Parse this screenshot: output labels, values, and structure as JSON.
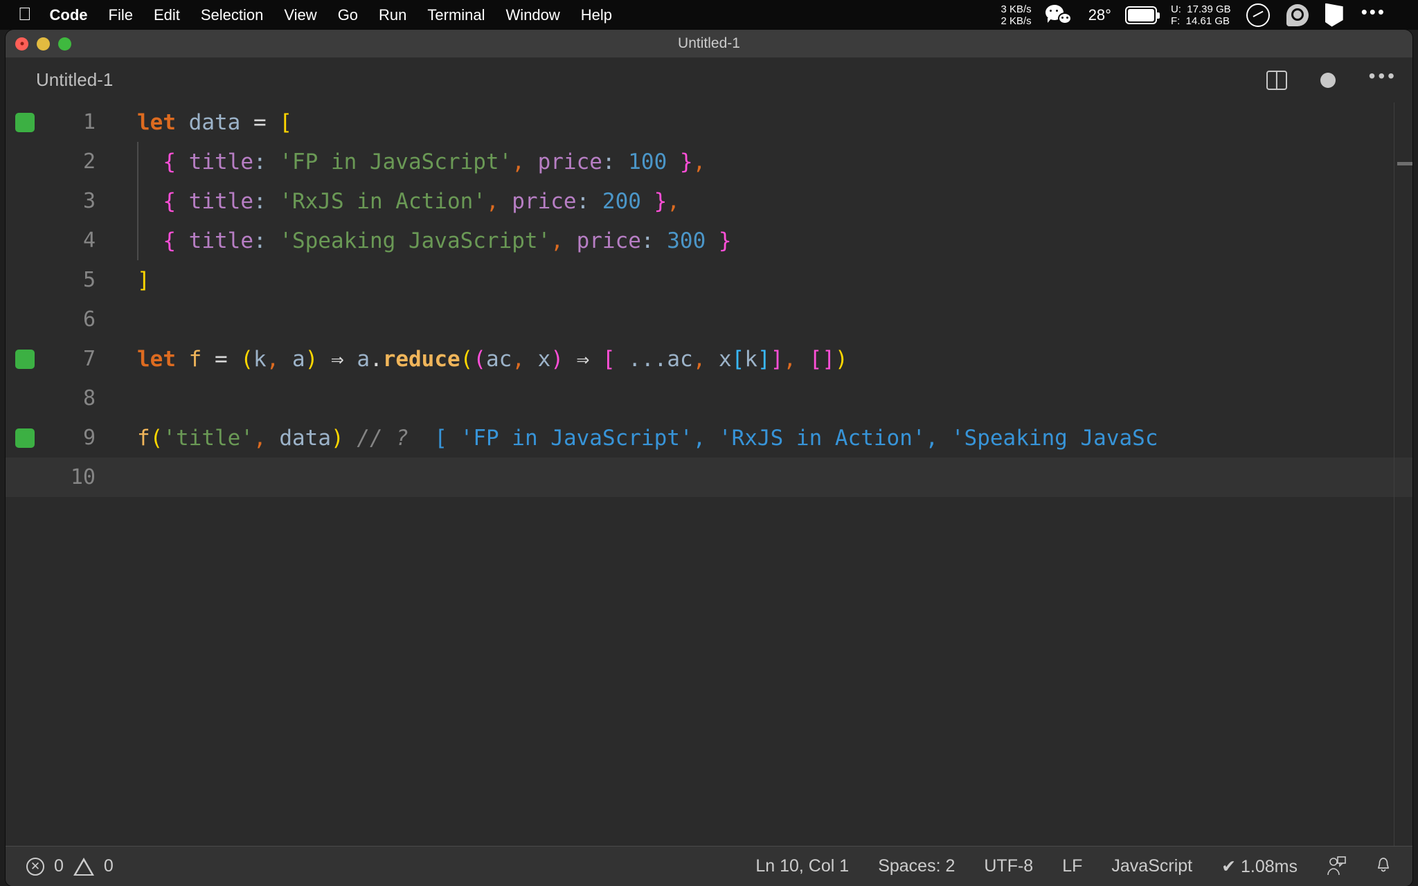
{
  "menubar": {
    "apple_icon": "apple-logo-icon",
    "items": [
      {
        "label": "Code",
        "bold": true
      },
      {
        "label": "File",
        "bold": false
      },
      {
        "label": "Edit",
        "bold": false
      },
      {
        "label": "Selection",
        "bold": false
      },
      {
        "label": "View",
        "bold": false
      },
      {
        "label": "Go",
        "bold": false
      },
      {
        "label": "Run",
        "bold": false
      },
      {
        "label": "Terminal",
        "bold": false
      },
      {
        "label": "Window",
        "bold": false
      },
      {
        "label": "Help",
        "bold": false
      }
    ],
    "tray": {
      "network_up": "3 KB/s",
      "network_down": "2 KB/s",
      "network_text": "3 KB/s\n2 KB/s",
      "wechat_icon": "wechat-icon",
      "temperature": "28°",
      "battery_icon": "battery-icon",
      "disk_used_label": "U:",
      "disk_used": "17.39 GB",
      "disk_free_label": "F:",
      "disk_free": "14.61 GB",
      "disk_text": "U:  17.39 GB\nF:  14.61 GB",
      "gauge_icon": "speedometer-icon",
      "swirl_icon": "spiral-app-icon",
      "flag_icon": "flag-icon",
      "overflow_icon": "ellipsis-icon",
      "overflow_label": "•••"
    }
  },
  "window": {
    "title": "Untitled-1",
    "traffic_lights": [
      "close",
      "minimize",
      "zoom"
    ]
  },
  "tabstrip": {
    "tab_label": "Untitled-1",
    "split_editor_icon": "split-editor-icon",
    "dirty_indicator": "unsaved-dot-icon",
    "more_actions_icon": "more-actions-icon",
    "more_actions_label": "•••"
  },
  "editor": {
    "language": "JavaScript",
    "lines": [
      {
        "n": "1",
        "marker": true,
        "active": false,
        "indent_guide": false
      },
      {
        "n": "2",
        "marker": false,
        "active": false,
        "indent_guide": true
      },
      {
        "n": "3",
        "marker": false,
        "active": false,
        "indent_guide": true
      },
      {
        "n": "4",
        "marker": false,
        "active": false,
        "indent_guide": true
      },
      {
        "n": "5",
        "marker": false,
        "active": false,
        "indent_guide": false
      },
      {
        "n": "6",
        "marker": false,
        "active": false,
        "indent_guide": false
      },
      {
        "n": "7",
        "marker": true,
        "active": false,
        "indent_guide": false
      },
      {
        "n": "8",
        "marker": false,
        "active": false,
        "indent_guide": false
      },
      {
        "n": "9",
        "marker": true,
        "active": false,
        "indent_guide": false
      },
      {
        "n": "10",
        "marker": false,
        "active": true,
        "indent_guide": false
      }
    ],
    "source_text": [
      "let data = [",
      "  { title: 'FP in JavaScript', price: 100 },",
      "  { title: 'RxJS in Action', price: 200 },",
      "  { title: 'Speaking JavaScript', price: 300 }",
      "]",
      "",
      "let f = (k, a) ⇒ a.reduce((ac, x) ⇒ [ ...ac, x[k]], [])",
      "",
      "f('title', data) // ? [ 'FP in JavaScript', 'RxJS in Action', 'Speaking JavaScript' ]",
      ""
    ],
    "code": {
      "l1": {
        "kw_let": "let",
        "var_data": " data ",
        "eq": "= ",
        "brk_open": "["
      },
      "l2": {
        "indent": "  ",
        "brace_open": "{",
        "prop": " title",
        "colon": ":",
        "str": " 'FP in JavaScript'",
        "comma": ",",
        "prop2": " price",
        "colon2": ":",
        "num": " 100",
        "brace_close": " }",
        "comma2": ","
      },
      "l3": {
        "indent": "  ",
        "brace_open": "{",
        "prop": " title",
        "colon": ":",
        "str": " 'RxJS in Action'",
        "comma": ",",
        "prop2": " price",
        "colon2": ":",
        "num": " 200",
        "brace_close": " }",
        "comma2": ","
      },
      "l4": {
        "indent": "  ",
        "brace_open": "{",
        "prop": " title",
        "colon": ":",
        "str": " 'Speaking JavaScript'",
        "comma": ",",
        "prop2": " price",
        "colon2": ":",
        "num": " 300",
        "brace_close": " }"
      },
      "l5": {
        "brk_close": "]"
      },
      "l7": {
        "kw_let": "let",
        "fn_name": " f ",
        "eq": "= ",
        "paren_open": "(",
        "p_k": "k",
        "comma1": ",",
        "p_a": " a",
        "paren_close": ")",
        "arrow": " ⇒ ",
        "obj_a": "a",
        "dot": ".",
        "method": "reduce",
        "paren_open2": "(",
        "paren_open3": "(",
        "p_ac": "ac",
        "comma2": ",",
        "p_x": " x",
        "paren_close2": ")",
        "arrow2": " ⇒ ",
        "brk_open": "[",
        "spread": " ...",
        "ac": "ac",
        "comma3": ",",
        "x": " x",
        "brk_open2": "[",
        "k": "k",
        "brk_close2": "]",
        "brk_close": "]",
        "comma4": ",",
        "brk_empty_open": " [",
        "brk_empty_close": "]",
        "paren_close3": ")"
      },
      "l9": {
        "fn_call": "f",
        "paren_open": "(",
        "arg_str": "'title'",
        "comma": ",",
        "arg_data": " data",
        "paren_close": ")",
        "comment": " // ?",
        "result": "  [ 'FP in JavaScript', 'RxJS in Action', 'Speaking JavaSc"
      }
    }
  },
  "statusbar": {
    "errors_icon": "error-circle-icon",
    "errors": "0",
    "warnings_icon": "warning-triangle-icon",
    "warnings": "0",
    "cursor_position": "Ln 10, Col 1",
    "indentation": "Spaces: 2",
    "encoding": "UTF-8",
    "eol": "LF",
    "language_mode": "JavaScript",
    "runtime_check": "✔",
    "runtime": "1.08ms",
    "runtime_full": "✔ 1.08ms",
    "feedback_icon": "feedback-person-icon",
    "bell_icon": "notifications-bell-icon",
    "bell_glyph": "🔔"
  },
  "colors": {
    "menubar_bg": "#0b0b0b",
    "window_bg": "#2b2b2b",
    "titlebar_bg": "#3c3c3c",
    "statusbar_bg": "#333333",
    "keyword": "#dd6b20",
    "string": "#6a9955",
    "number": "#4b96c8",
    "property": "#b77ec4",
    "variable": "#9cb3c9",
    "comment": "#848484",
    "bracket_yellow": "#ffd700",
    "bracket_magenta": "#ff4fd8",
    "bracket_cyan": "#39b9ff",
    "result_blue": "#3794d8",
    "marker_green": "#3cb043",
    "function": "#f0b55a"
  }
}
